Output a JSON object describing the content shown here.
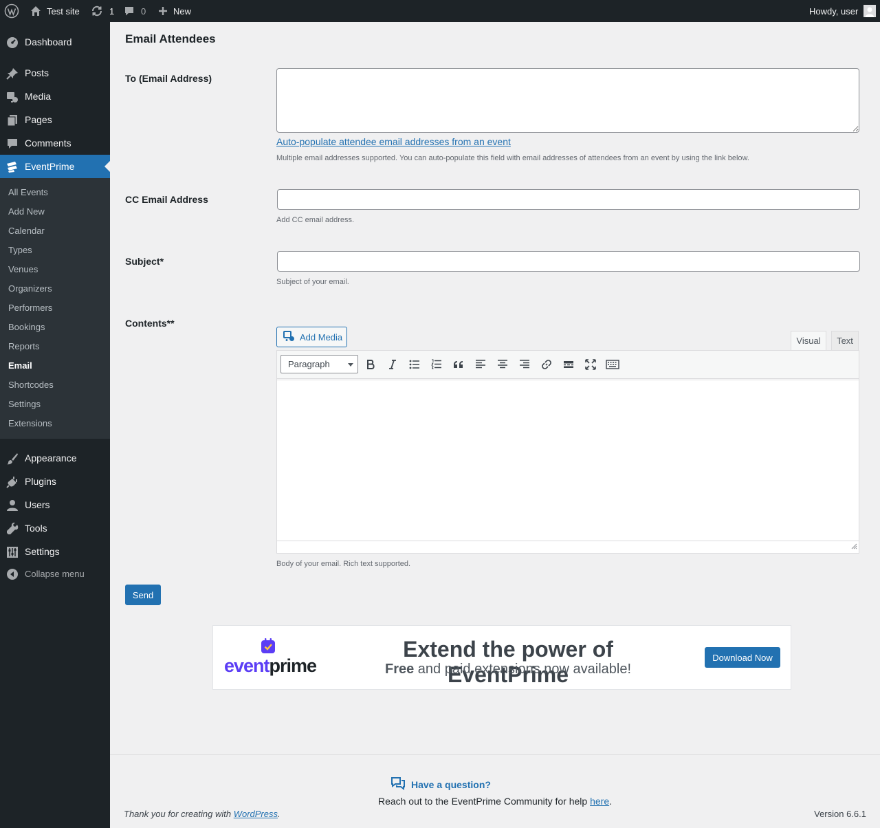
{
  "adminbar": {
    "site_name": "Test site",
    "updates_count": "1",
    "comments_count": "0",
    "new_label": "New",
    "howdy": "Howdy, user"
  },
  "menu": {
    "dashboard": "Dashboard",
    "posts": "Posts",
    "media": "Media",
    "pages": "Pages",
    "comments": "Comments",
    "eventprime": "EventPrime",
    "appearance": "Appearance",
    "plugins": "Plugins",
    "users": "Users",
    "tools": "Tools",
    "settings": "Settings",
    "collapse": "Collapse menu"
  },
  "submenu": [
    "All Events",
    "Add New",
    "Calendar",
    "Types",
    "Venues",
    "Organizers",
    "Performers",
    "Bookings",
    "Reports",
    "Email",
    "Shortcodes",
    "Settings",
    "Extensions"
  ],
  "page": {
    "title": "Email Attendees",
    "to_label": "To (Email Address)",
    "autopopulate_link": "Auto-populate attendee email addresses from an event",
    "to_desc": "Multiple email addresses supported. You can auto-populate this field with email addresses of attendees from an event by using the link below.",
    "cc_label": "CC Email Address",
    "cc_desc": "Add CC email address.",
    "subject_label": "Subject*",
    "subject_desc": "Subject of your email.",
    "contents_label": "Contents**",
    "add_media": "Add Media",
    "tab_visual": "Visual",
    "tab_text": "Text",
    "format_select": "Paragraph",
    "contents_desc": "Body of your email. Rich text supported.",
    "send": "Send"
  },
  "banner": {
    "logo_part1": "event",
    "logo_part2": "prime",
    "heading": "Extend the power of EventPrime",
    "sub_bold": "Free",
    "sub_rest": " and paid extensions now available!",
    "button": "Download Now"
  },
  "footer": {
    "question": "Have a question?",
    "reach_prefix": "Reach out to the EventPrime Community for help ",
    "reach_link": "here",
    "reach_suffix": ".",
    "thanks_prefix": "Thank you for creating with ",
    "thanks_link": "WordPress",
    "thanks_suffix": ".",
    "version": "Version 6.6.1"
  },
  "colors": {
    "admin_dark": "#1d2327",
    "submenu_bg": "#2c3338",
    "accent_blue": "#2271b1",
    "content_bg": "#f0f0f1",
    "logo_purple": "#5b3df5"
  }
}
